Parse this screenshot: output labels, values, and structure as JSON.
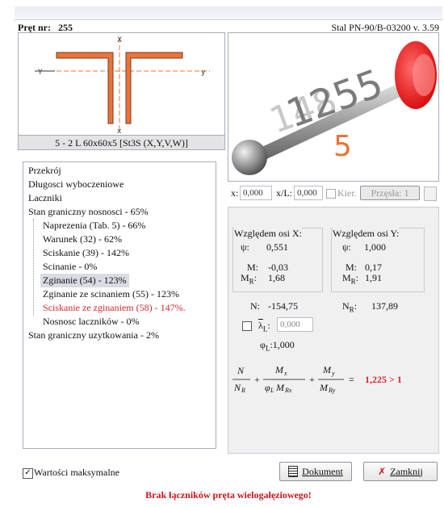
{
  "header": {
    "bar_label": "Pręt nr:",
    "bar_number": "255",
    "standard": "Stal PN-90/B-03200 v. 3.59"
  },
  "section": {
    "caption": "5 - 2 L 60x60x5  [St3S (X,Y,V,W)]",
    "axis_x": "X",
    "axis_y": "Y",
    "axis_x_lower": "x",
    "axis_y_lower": "y"
  },
  "render3d": {
    "bar_label": "1255",
    "sub_label": "5",
    "behind_label": "148"
  },
  "tree": {
    "items": [
      {
        "label": "Przekrój"
      },
      {
        "label": "Długosci wyboczeniowe"
      },
      {
        "label": "Laczniki"
      },
      {
        "label": "Stan graniczny nosnosci - 65%"
      },
      {
        "label": "Naprezenia (Tab. 5) - 66%"
      },
      {
        "label": "Warunek (32) - 62%"
      },
      {
        "label": "Sciskanie (39) - 142%"
      },
      {
        "label": "Scinanie - 0%"
      },
      {
        "label": "Zginanie (54) - 123%"
      },
      {
        "label": "Zginanie ze scinaniem (55) - 123%"
      },
      {
        "label": "Sciskanie ze zginaniem (58) - 147%."
      },
      {
        "label": "Nosnosc laczników - 0%"
      },
      {
        "label": "Stan graniczny uzytkowania - 2%"
      }
    ]
  },
  "toolbar": {
    "x_label": "x:",
    "x_value": "0,000",
    "xl_label": "x/L:",
    "xl_value": "0,000",
    "kier_label": "Kier.",
    "przesla_label": "Przęsła: 1"
  },
  "results": {
    "group_x_title": "Względem osi X:",
    "group_y_title": "Względem osi Y:",
    "psi_label": "ψ:",
    "psi_x": "0,551",
    "psi_y": "1,000",
    "m_label": "M:",
    "m_x": "-0,03",
    "m_y": "0,17",
    "mr_label": "M",
    "mr_sub": "R",
    "mr_colon": ":",
    "mr_x": "1,68",
    "mr_y": "1,91",
    "n_label": "N:",
    "n_value": "-154,75",
    "nr_label": "N",
    "nr_sub": "R",
    "nr_colon": ":",
    "nr_value": "137,89",
    "lambda_label": "λ",
    "lambda_sub": "L",
    "lambda_colon": ":",
    "lambda_value": "0,000",
    "phi_label": "φ",
    "phi_sub": "L",
    "phi_value": ":1,000",
    "formula": {
      "n": "N",
      "nr": "N",
      "nr_sub": "R",
      "plus": "+",
      "mx": "M",
      "mx_sub": "x",
      "phil": "φ",
      "phil_sub": "L",
      "mrx": "M",
      "mrx_sub": "Rx",
      "my": "M",
      "my_sub": "y",
      "mry": "M",
      "mry_sub": "Ry",
      "eq": "="
    },
    "result": "1,225 > 1"
  },
  "footer": {
    "checkbox_label": "Wartości maksymalne",
    "checkbox_checked": true,
    "dokument_label": "Dokument",
    "zamknij_label": "Zamknij",
    "status": "Brak łączników pręta wielogałęziowego!"
  },
  "colors": {
    "accent_red": "#d7262a",
    "profile_orange": "#e8743b",
    "status_red": "#c8141c"
  }
}
